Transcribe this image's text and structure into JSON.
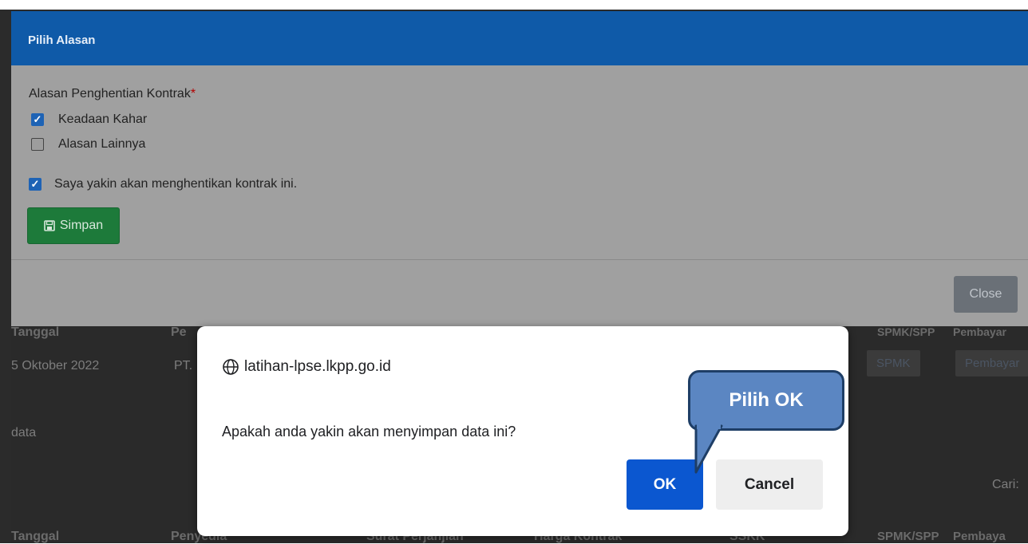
{
  "modal": {
    "title": "Pilih Alasan",
    "field_label": "Alasan Penghentian Kontrak",
    "required_mark": "*",
    "options": [
      {
        "label": "Keadaan Kahar",
        "checked": true
      },
      {
        "label": "Alasan Lainnya",
        "checked": false
      }
    ],
    "confirm_label": "Saya yakin akan menghentikan kontrak ini.",
    "confirm_checked": true,
    "save_label": "Simpan",
    "close_label": "Close"
  },
  "background": {
    "header1": [
      "Tanggal",
      "Pe",
      "SPMK/SPP",
      "Pembayar"
    ],
    "row1": [
      "5 Oktober 2022",
      "PT."
    ],
    "row1_buttons": [
      "SPMK",
      "Pembayar"
    ],
    "data_text": "data",
    "search_label": "Cari:",
    "header2": [
      "Tanggal",
      "Penyedia",
      "Surat Perjanjian",
      "Harga Kontrak",
      "SSKK",
      "SPMK/SPP",
      "Pembaya"
    ]
  },
  "dialog": {
    "origin": "latihan-lpse.lkpp.go.id",
    "message": "Apakah anda yakin akan menyimpan data ini?",
    "ok_label": "OK",
    "cancel_label": "Cancel"
  },
  "callout": {
    "text": "Pilih OK"
  },
  "colors": {
    "header_blue": "#0f5aa8",
    "ok_blue": "#0b57d0",
    "save_green": "#1d7a3a",
    "callout_fill": "#5b86c2"
  }
}
